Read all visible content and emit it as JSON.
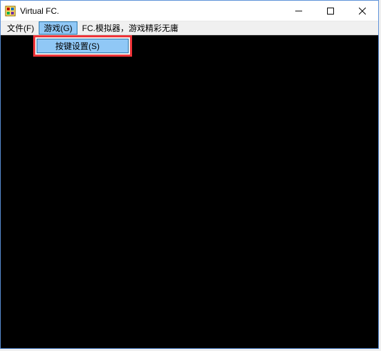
{
  "titlebar": {
    "title": "Virtual FC."
  },
  "menubar": {
    "items": [
      {
        "label": "文件(F)"
      },
      {
        "label": "游戏(G)"
      },
      {
        "label": "FC.模拟器，游戏精彩无庸"
      }
    ],
    "active_index": 1
  },
  "dropdown": {
    "items": [
      {
        "label": "按键设置(S)"
      }
    ],
    "highlighted_index": 0
  },
  "colors": {
    "highlight_border": "#ee3338",
    "menu_active_bg": "#90c8f6",
    "content_bg": "#000000"
  }
}
